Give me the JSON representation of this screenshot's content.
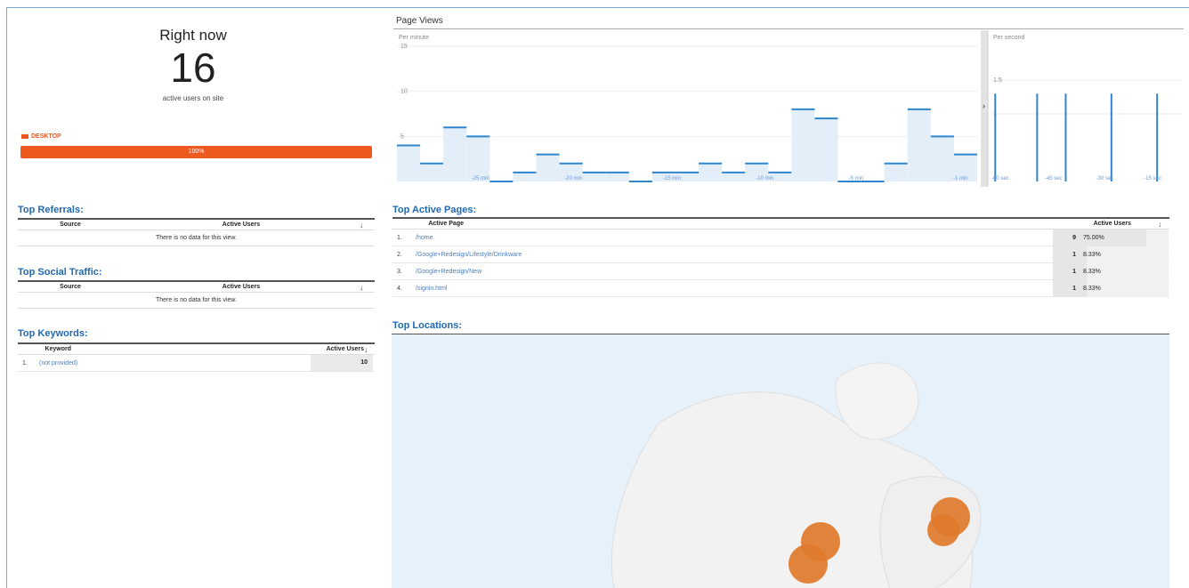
{
  "right_now": {
    "title": "Right now",
    "count": "16",
    "subtitle": "active users on site",
    "device_label": "DESKTOP",
    "device_percent": "100%",
    "device_fraction": 1.0,
    "accent_color": "#ee5a1e"
  },
  "page_views": {
    "title": "Page Views",
    "per_minute_label": "Per minute",
    "per_second_label": "Per second",
    "toggle_icon": "chevron-right-icon"
  },
  "chart_data": [
    {
      "type": "bar",
      "title": "Per minute",
      "x_ticks": [
        "-25 min",
        "-20 min",
        "-15 min",
        "-10 min",
        "-5 min",
        "-1 min"
      ],
      "values": [
        4,
        2,
        6,
        5,
        0,
        1,
        3,
        2,
        1,
        1,
        0,
        1,
        1,
        2,
        1,
        2,
        1,
        8,
        7,
        0,
        0,
        2,
        8,
        5,
        3
      ],
      "y_ticks": [
        "15",
        "10",
        "5"
      ]
    },
    {
      "type": "bar",
      "title": "Per second",
      "x_ticks": [
        "-60 sec",
        "-45 sec",
        "-30 sec",
        "-15 sec"
      ],
      "values": [
        1,
        1,
        1,
        1,
        1
      ],
      "y_ticks": [
        "1.5",
        "1"
      ]
    }
  ],
  "top_referrals": {
    "title": "Top Referrals:",
    "col_source": "Source",
    "col_users": "Active Users",
    "empty": "There is no data for this view."
  },
  "top_social": {
    "title": "Top Social Traffic:",
    "col_source": "Source",
    "col_users": "Active Users",
    "empty": "There is no data for this view."
  },
  "top_keywords": {
    "title": "Top Keywords:",
    "col_keyword": "Keyword",
    "col_users": "Active Users",
    "rows": [
      {
        "index": "1.",
        "keyword": "(not provided)",
        "users": "10"
      }
    ]
  },
  "top_pages": {
    "title": "Top Active Pages:",
    "col_page": "Active Page",
    "col_users": "Active Users",
    "rows": [
      {
        "index": "1.",
        "page": "/home",
        "users": "9",
        "percent": "75.00%"
      },
      {
        "index": "2.",
        "page": "/Google+Redesign/Lifestyle/Drinkware",
        "users": "1",
        "percent": "8.33%"
      },
      {
        "index": "3.",
        "page": "/Google+Redesign/New",
        "users": "1",
        "percent": "8.33%"
      },
      {
        "index": "4.",
        "page": "/signin.html",
        "users": "1",
        "percent": "8.33%"
      }
    ]
  },
  "top_locations": {
    "title": "Top Locations:",
    "marker_color": "#e07a2b"
  }
}
